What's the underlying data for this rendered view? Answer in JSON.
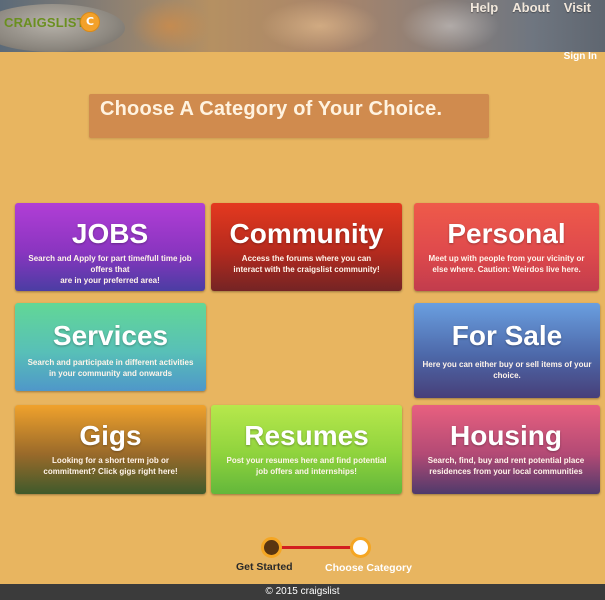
{
  "header": {
    "logo_text": "CRAIGSLIST",
    "logo_badge": "C",
    "nav": [
      "Help",
      "About",
      "Visit"
    ],
    "signin": "Sign In"
  },
  "main": {
    "title": "Choose A Category of Your Choice.",
    "categories": {
      "jobs": {
        "name": "JOBS",
        "desc": "Search and Apply for part time/full time job\noffers that\nare in your preferred area!"
      },
      "community": {
        "name": "Community",
        "desc": "Access the forums where you can\ninteract with the craigslist community!"
      },
      "personal": {
        "name": "Personal",
        "desc": "Meet up with people from your vicinity or\nelse where. Caution: Weirdos live here."
      },
      "services": {
        "name": "Services",
        "desc": "Search and participate in different  activities\nin your community  and onwards"
      },
      "forsale": {
        "name": "For Sale",
        "desc": "Here you can either buy or sell items of your\nchoice."
      },
      "gigs": {
        "name": "Gigs",
        "desc": "Looking for a  short term job or\ncommitment? Click gigs right here!"
      },
      "resumes": {
        "name": "Resumes",
        "desc": "Post your resumes here and find potential\njob offers and internships!"
      },
      "housing": {
        "name": "Housing",
        "desc": "Search, find, buy and rent  potential place\nresidences from your local communities"
      }
    }
  },
  "progress": {
    "step1": "Get Started",
    "step2": "Choose Category"
  },
  "footer": {
    "text": "© 2015 craigslist"
  },
  "colors": {
    "background": "#e8b560",
    "title_box": "#d08b4e",
    "progress_line": "#d31f1f",
    "progress_ring": "#f5a623",
    "footer": "#3b3b3b"
  }
}
